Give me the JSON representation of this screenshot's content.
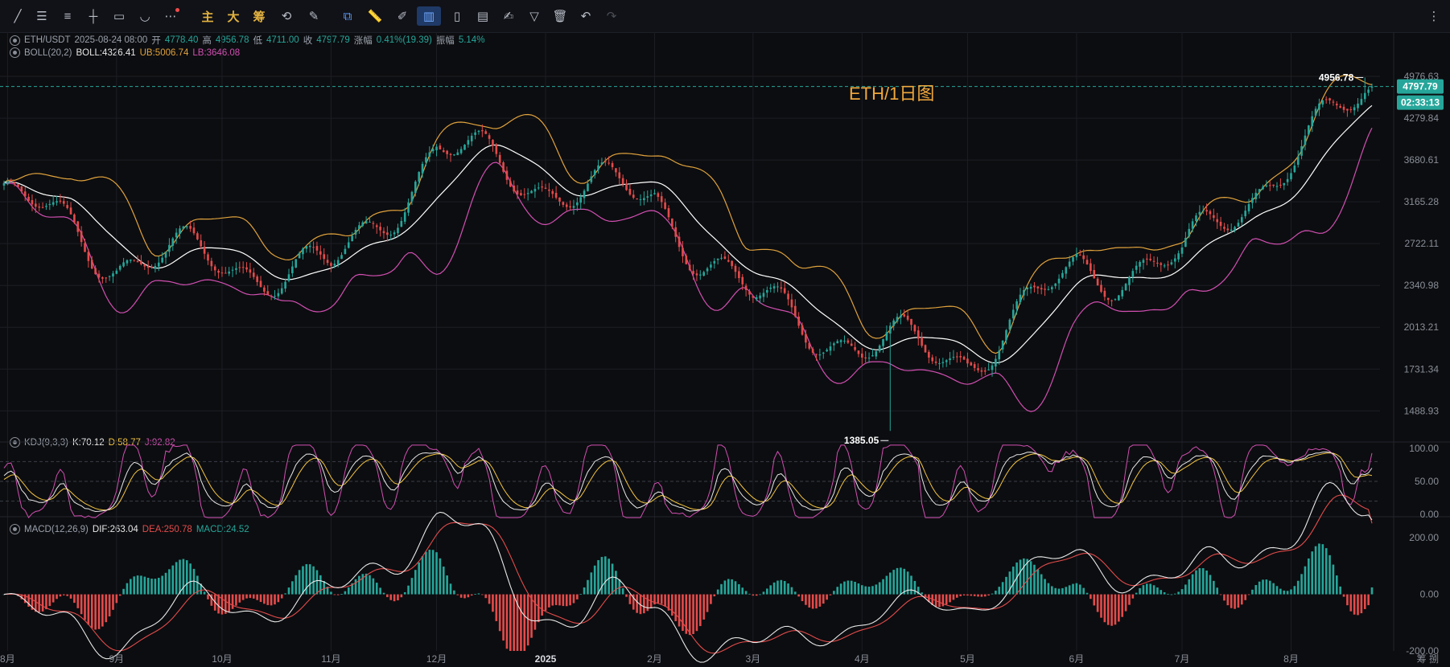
{
  "toolbar": {
    "cn_main": "主",
    "cn_big": "大",
    "cn_chip": "筹"
  },
  "header": {
    "symbol": "ETH/USDT",
    "datetime": "2025-08-24 08:00",
    "open_label": "开",
    "open": "4778.40",
    "high_label": "高",
    "high": "4956.78",
    "low_label": "低",
    "low": "4711.00",
    "close_label": "收",
    "close": "4797.79",
    "change_label": "涨幅",
    "change": "0.41%(19.39)",
    "amp_label": "振幅",
    "amp": "5.14%"
  },
  "boll_legend": {
    "name": "BOLL(20,2)",
    "mid": "BOLL:4326.41",
    "ub": "UB:5006.74",
    "lb": "LB:3646.08"
  },
  "kdj_legend": {
    "name": "KDJ(9,3,3)",
    "k": "K:70.12",
    "d": "D:58.77",
    "j": "J:92.82"
  },
  "macd_legend": {
    "name": "MACD(12,26,9)",
    "dif": "DIF:263.04",
    "dea": "DEA:250.78",
    "macd": "MACD:24.52"
  },
  "chart_title": "ETH/1日图",
  "annotations": {
    "high_mark": "4956.78",
    "low_mark": "1385.05"
  },
  "price_tags": {
    "last_price": "4797.79",
    "countdown": "02:33:13"
  },
  "corner_label": "筹 捌",
  "chart_data": [
    {
      "type": "candlestick",
      "title": "ETH/1日图",
      "y_scale": "log",
      "yticks": [
        "4976.63",
        "4279.84",
        "3680.61",
        "3165.28",
        "2722.11",
        "2340.98",
        "2013.21",
        "1731.34",
        "1488.93"
      ],
      "xticks": [
        "8月",
        "9月",
        "10月",
        "11月",
        "12月",
        "2025",
        "2月",
        "3月",
        "4月",
        "5月",
        "6月",
        "7月",
        "8月"
      ],
      "key_points_x": [
        "2024-07-31",
        "2024-09-01",
        "2024-10-01",
        "2024-11-01",
        "2024-12-01",
        "2025-01-01",
        "2025-02-01",
        "2025-03-01",
        "2025-04-01",
        "2025-05-01",
        "2025-06-01",
        "2025-07-01",
        "2025-08-01",
        "2025-08-24"
      ],
      "key_points_close": [
        3230,
        2500,
        2600,
        2510,
        3700,
        3350,
        3300,
        2200,
        1820,
        1840,
        2530,
        2490,
        3700,
        4797.79
      ],
      "highest": 4956.78,
      "lowest": 1385.05,
      "series": [
        {
          "name": "BOLL",
          "color": "#ffffff"
        },
        {
          "name": "UB",
          "color": "#e0a23d"
        },
        {
          "name": "LB",
          "color": "#d14fb2"
        }
      ]
    },
    {
      "type": "line",
      "title": "KDJ(9,3,3)",
      "yticks": [
        "100.00",
        "50.00",
        "0.00"
      ],
      "ylim": [
        0,
        100
      ],
      "last": {
        "K": 70.12,
        "D": 58.77,
        "J": 92.82
      },
      "series": [
        {
          "name": "K",
          "color": "#e8e8e8"
        },
        {
          "name": "D",
          "color": "#f5c542"
        },
        {
          "name": "J",
          "color": "#d14fb2"
        }
      ]
    },
    {
      "type": "bar",
      "title": "MACD(12,26,9)",
      "yticks": [
        "200.00",
        "0.00",
        "-200.00"
      ],
      "ylim": [
        -200,
        260
      ],
      "last": {
        "DIF": 263.04,
        "DEA": 250.78,
        "MACD": 24.52
      },
      "series": [
        {
          "name": "DIF",
          "color": "#e8e8e8"
        },
        {
          "name": "DEA",
          "color": "#e34b4b"
        },
        {
          "name": "MACD",
          "color": "#26a69a"
        }
      ]
    }
  ],
  "colors": {
    "up": "#26a69a",
    "down": "#e34b4b",
    "grid": "#1c1e25",
    "bg": "#0c0d10"
  }
}
